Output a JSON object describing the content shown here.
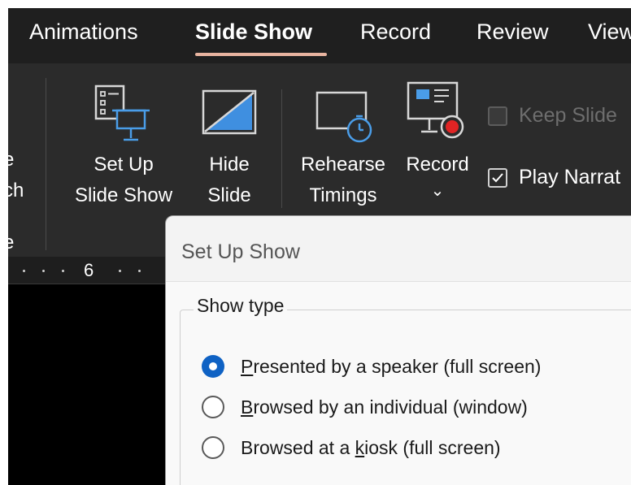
{
  "tabs": [
    {
      "label": "Animations",
      "active": false
    },
    {
      "label": "Slide Show",
      "active": true
    },
    {
      "label": "Record",
      "active": false
    },
    {
      "label": "Review",
      "active": false
    },
    {
      "label": "View",
      "active": false
    }
  ],
  "ribbon": {
    "left_cut": {
      "line1": "e",
      "line2": "ch",
      "line3": "e"
    },
    "setup_show": {
      "line1": "Set Up",
      "line2": "Slide Show"
    },
    "hide_slide": {
      "line1": "Hide",
      "line2": "Slide"
    },
    "rehearse": {
      "line1": "Rehearse",
      "line2": "Timings"
    },
    "record": {
      "label": "Record",
      "caret": "⌄"
    },
    "keep_slide": {
      "label": "Keep Slide",
      "checked": false,
      "enabled": false
    },
    "play_narrations": {
      "label": "Play Narrat",
      "checked": true
    }
  },
  "ruler": {
    "number": "6"
  },
  "dialog": {
    "title": "Set Up Show",
    "show_type": {
      "legend": "Show type",
      "options": [
        {
          "pre": "",
          "key": "P",
          "post": "resented by a speaker (full screen)",
          "checked": true
        },
        {
          "pre": "",
          "key": "B",
          "post": "rowsed by an individual (window)",
          "checked": false
        },
        {
          "pre": "Browsed at a ",
          "key": "k",
          "post": "iosk (full screen)",
          "checked": false
        }
      ]
    }
  },
  "colors": {
    "tabbar_bg": "#1f1f1f",
    "ribbon_bg": "#2b2b2b",
    "accent_blue": "#0f62c4",
    "tab_underline": "#e8b4a0",
    "record_red": "#e02424"
  }
}
